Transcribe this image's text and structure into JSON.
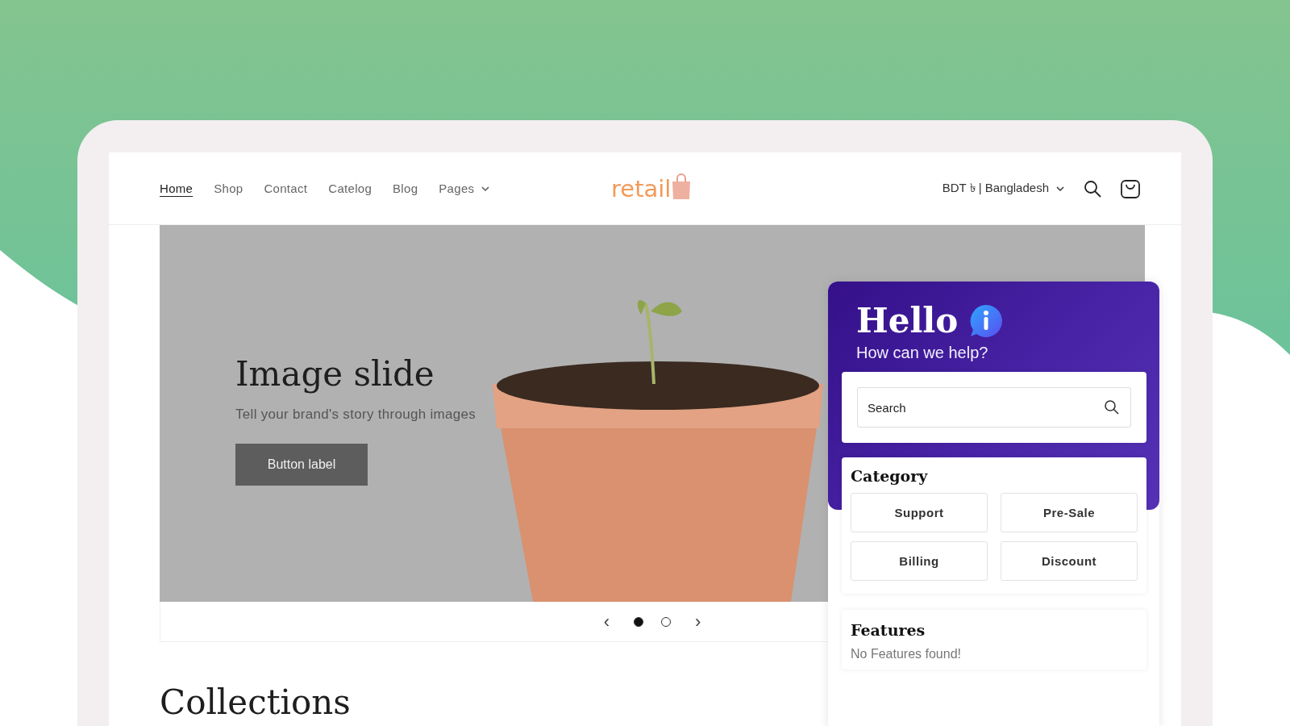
{
  "nav": {
    "items": [
      {
        "label": "Home",
        "selected": true
      },
      {
        "label": "Shop",
        "selected": false
      },
      {
        "label": "Contact",
        "selected": false
      },
      {
        "label": "Catelog",
        "selected": false
      },
      {
        "label": "Blog",
        "selected": false
      },
      {
        "label": "Pages",
        "selected": false,
        "dropdown": true
      }
    ],
    "logo": "retail",
    "currency": "BDT ৳ | Bangladesh"
  },
  "hero": {
    "title": "Image slide",
    "subtitle": "Tell your brand's story through images",
    "button": "Button label",
    "prev": "‹",
    "next": "›",
    "dots": [
      {
        "selected": true
      },
      {
        "selected": false
      }
    ]
  },
  "collections_heading": "Collections",
  "widget": {
    "title": "Hello",
    "subtitle": "How can we help?",
    "search": {
      "placeholder": "Search"
    },
    "category": {
      "heading": "Category",
      "buttons": [
        "Support",
        "Pre-Sale",
        "Billing",
        "Discount"
      ]
    },
    "features": {
      "heading": "Features",
      "empty": "No Features found!"
    }
  }
}
